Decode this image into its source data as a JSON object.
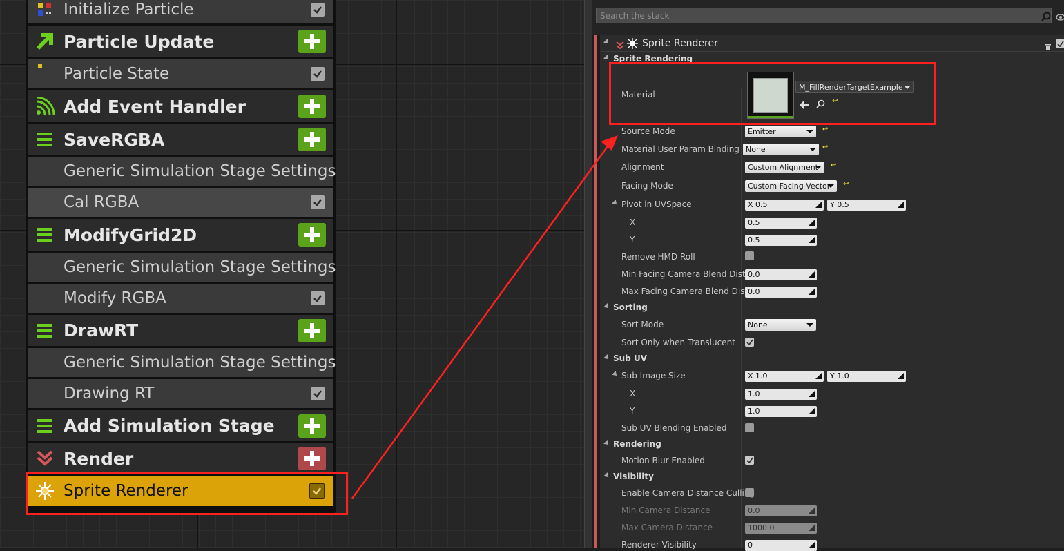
{
  "node_panel": {
    "rows": [
      {
        "label": "Initialize Particle",
        "kind": "sub",
        "checked": true
      },
      {
        "label": "Particle Update",
        "kind": "header",
        "icon": "arrow-up-right-icon"
      },
      {
        "label": "Particle State",
        "kind": "sub",
        "checked": true
      },
      {
        "label": "Add Event Handler",
        "kind": "header",
        "icon": "event-signal-icon"
      },
      {
        "label": "SaveRGBA",
        "kind": "header",
        "icon": "stage-bars-icon"
      },
      {
        "label": "Generic Simulation Stage Settings",
        "kind": "sub"
      },
      {
        "label": "Cal RGBA",
        "kind": "sub",
        "checked": true
      },
      {
        "label": "ModifyGrid2D",
        "kind": "header",
        "icon": "stage-bars-icon"
      },
      {
        "label": "Generic Simulation Stage Settings",
        "kind": "sub"
      },
      {
        "label": "Modify RGBA",
        "kind": "sub",
        "checked": true
      },
      {
        "label": "DrawRT",
        "kind": "header",
        "icon": "stage-bars-icon"
      },
      {
        "label": "Generic Simulation Stage Settings",
        "kind": "sub"
      },
      {
        "label": "Drawing RT",
        "kind": "sub",
        "checked": true
      },
      {
        "label": "Add Simulation Stage",
        "kind": "header",
        "icon": "stage-bars-icon"
      },
      {
        "label": "Render",
        "kind": "header",
        "icon": "render-chevron-icon",
        "accent": "#b0474a"
      },
      {
        "label": "Sprite Renderer",
        "kind": "selected",
        "icon": "sprite-burst-icon",
        "checked": true
      }
    ],
    "add_button_color": "#5ba31a",
    "selected_color": "#dba307"
  },
  "stack": {
    "search_placeholder": "Search the stack",
    "renderer_title": "Sprite Renderer",
    "sections": {
      "sprite_rendering": "Sprite Rendering",
      "sorting": "Sorting",
      "sub_uv": "Sub UV",
      "rendering": "Rendering",
      "visibility": "Visibility"
    },
    "material": {
      "label": "Material",
      "value": "M_FillRenderTargetExample"
    },
    "source_mode": {
      "label": "Source Mode",
      "value": "Emitter"
    },
    "material_user_param": {
      "label": "Material User Param Binding",
      "value": "None"
    },
    "alignment": {
      "label": "Alignment",
      "value": "Custom Alignment"
    },
    "facing_mode": {
      "label": "Facing Mode",
      "value": "Custom Facing Vector"
    },
    "pivot": {
      "label": "Pivot in UVSpace",
      "x_label": "X",
      "y_label": "Y",
      "x_value": "0.5",
      "y_value": "0.5",
      "x_inline": "X  0.5",
      "y_inline": "Y  0.5"
    },
    "remove_hmd_roll": {
      "label": "Remove HMD Roll",
      "checked": false
    },
    "min_facing": {
      "label": "Min Facing Camera Blend Distanc",
      "value": "0.0"
    },
    "max_facing": {
      "label": "Max Facing Camera Blend Distanc",
      "value": "0.0"
    },
    "sort_mode": {
      "label": "Sort Mode",
      "value": "None"
    },
    "sort_only_translucent": {
      "label": "Sort Only when Translucent",
      "checked": true
    },
    "sub_image_size": {
      "label": "Sub Image Size",
      "x_label": "X",
      "y_label": "Y",
      "x_value": "1.0",
      "y_value": "1.0",
      "x_inline": "X  1.0",
      "y_inline": "Y  1.0"
    },
    "sub_uv_blending": {
      "label": "Sub UV Blending Enabled",
      "checked": false
    },
    "motion_blur": {
      "label": "Motion Blur Enabled",
      "checked": true
    },
    "enable_cam_culling": {
      "label": "Enable Camera Distance Culling",
      "checked": false
    },
    "min_cam_dist": {
      "label": "Min Camera Distance",
      "value": "0.0"
    },
    "max_cam_dist": {
      "label": "Max Camera Distance",
      "value": "1000.0"
    },
    "renderer_visibility": {
      "label": "Renderer Visibility",
      "value": "0"
    },
    "reset_glyph": "↩",
    "highlight_color": "#ff2020"
  }
}
